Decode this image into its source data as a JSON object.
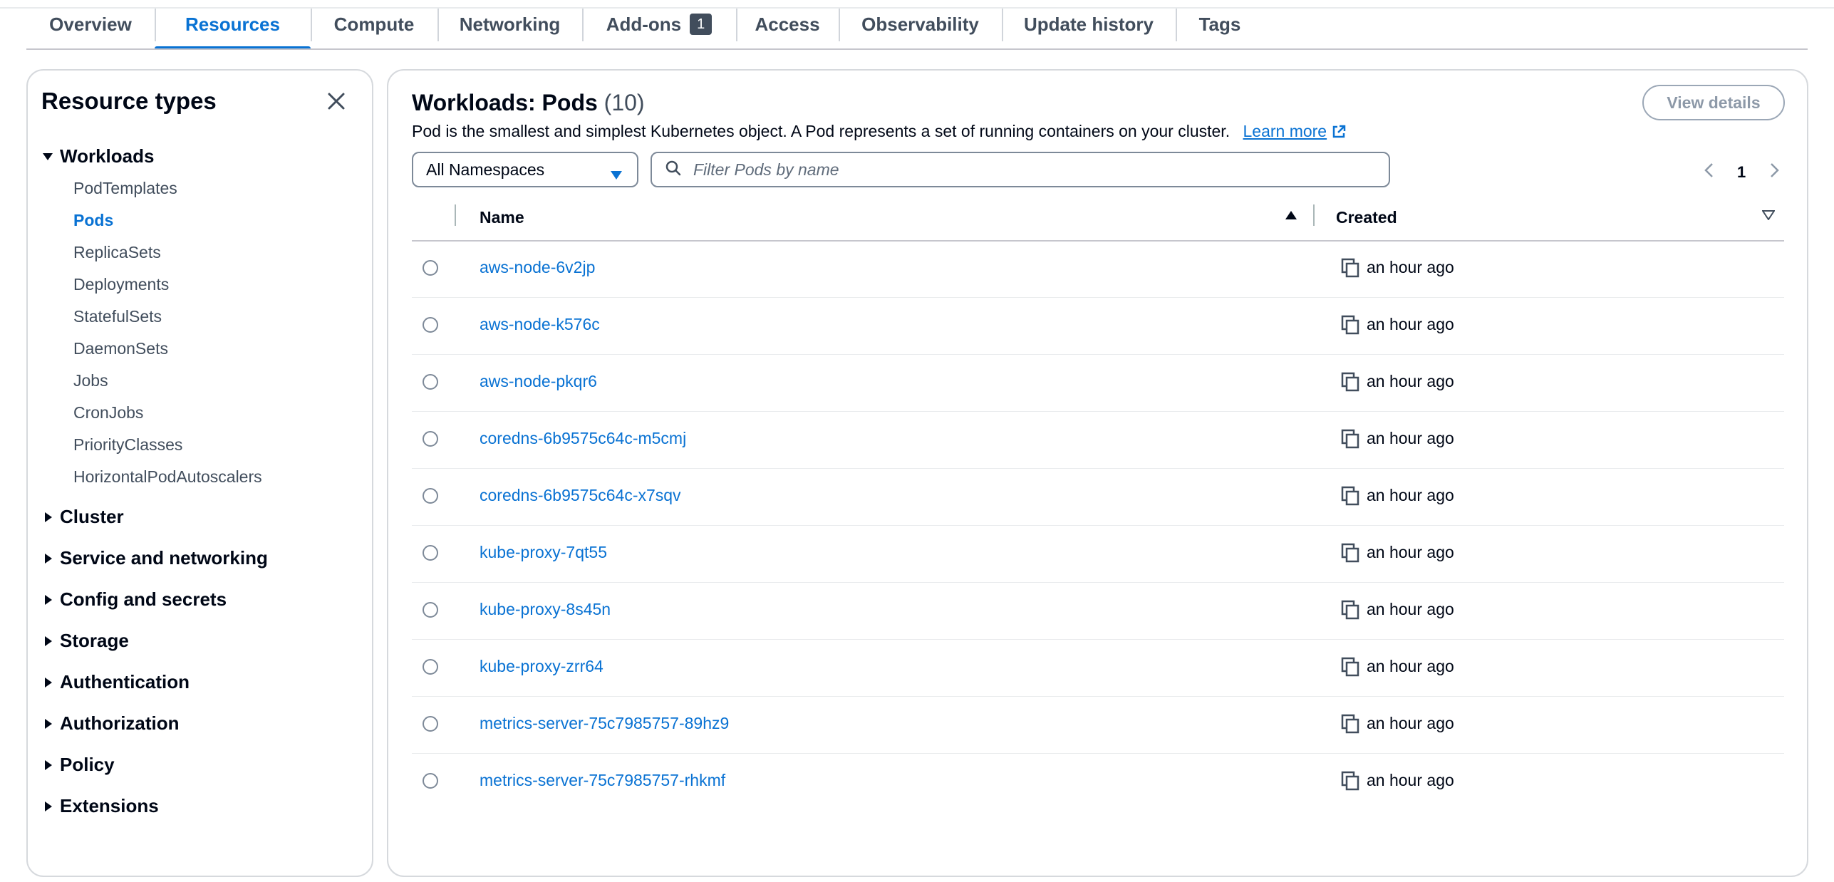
{
  "tabs": [
    {
      "label": "Overview"
    },
    {
      "label": "Resources",
      "active": true
    },
    {
      "label": "Compute"
    },
    {
      "label": "Networking"
    },
    {
      "label": "Add-ons",
      "badge": "1"
    },
    {
      "label": "Access"
    },
    {
      "label": "Observability"
    },
    {
      "label": "Update history"
    },
    {
      "label": "Tags"
    }
  ],
  "sidebar": {
    "title": "Resource types",
    "workloads": {
      "label": "Workloads",
      "expanded": true,
      "items": [
        {
          "label": "PodTemplates"
        },
        {
          "label": "Pods",
          "selected": true
        },
        {
          "label": "ReplicaSets"
        },
        {
          "label": "Deployments"
        },
        {
          "label": "StatefulSets"
        },
        {
          "label": "DaemonSets"
        },
        {
          "label": "Jobs"
        },
        {
          "label": "CronJobs"
        },
        {
          "label": "PriorityClasses"
        },
        {
          "label": "HorizontalPodAutoscalers"
        }
      ]
    },
    "groups": [
      {
        "label": "Cluster"
      },
      {
        "label": "Service and networking"
      },
      {
        "label": "Config and secrets"
      },
      {
        "label": "Storage"
      },
      {
        "label": "Authentication"
      },
      {
        "label": "Authorization"
      },
      {
        "label": "Policy"
      },
      {
        "label": "Extensions"
      }
    ]
  },
  "main": {
    "title": "Workloads: Pods",
    "count": "(10)",
    "view_details": "View details",
    "description": "Pod is the smallest and simplest Kubernetes object. A Pod represents a set of running containers on your cluster.",
    "learn_more": "Learn more",
    "namespace_select": "All Namespaces",
    "filter_placeholder": "Filter Pods by name",
    "page": "1",
    "columns": {
      "name": "Name",
      "created": "Created"
    },
    "rows": [
      {
        "name": "aws-node-6v2jp",
        "created": "an hour ago"
      },
      {
        "name": "aws-node-k576c",
        "created": "an hour ago"
      },
      {
        "name": "aws-node-pkqr6",
        "created": "an hour ago"
      },
      {
        "name": "coredns-6b9575c64c-m5cmj",
        "created": "an hour ago"
      },
      {
        "name": "coredns-6b9575c64c-x7sqv",
        "created": "an hour ago"
      },
      {
        "name": "kube-proxy-7qt55",
        "created": "an hour ago"
      },
      {
        "name": "kube-proxy-8s45n",
        "created": "an hour ago"
      },
      {
        "name": "kube-proxy-zrr64",
        "created": "an hour ago"
      },
      {
        "name": "metrics-server-75c7985757-89hz9",
        "created": "an hour ago"
      },
      {
        "name": "metrics-server-75c7985757-rhkmf",
        "created": "an hour ago"
      }
    ]
  },
  "colors": {
    "accent": "#0972d3",
    "text": "#000716",
    "muted": "#414d5c",
    "border": "#d6d9dd"
  }
}
